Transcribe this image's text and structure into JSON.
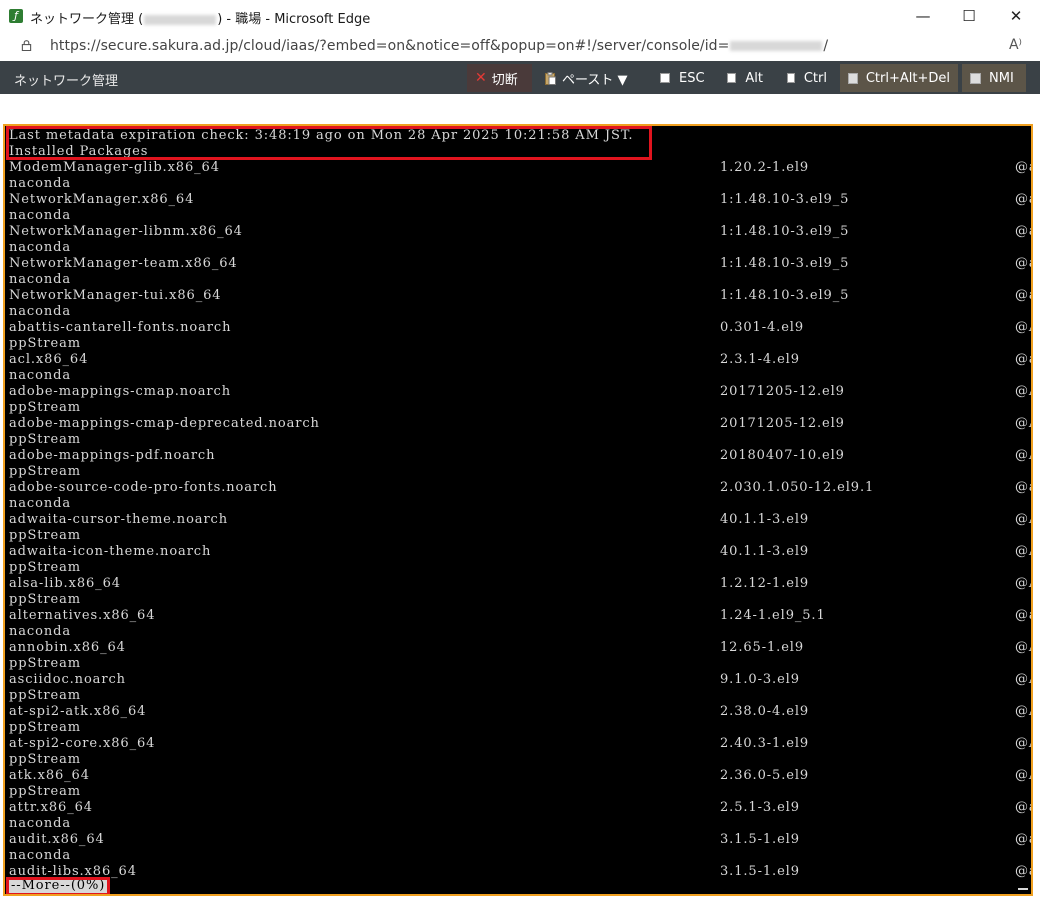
{
  "window": {
    "title_prefix": "ネットワーク管理 (",
    "title_suffix": ") - 職場 - Microsoft Edge",
    "minimize_glyph": "—",
    "maximize_glyph": "☐",
    "close_glyph": "✕"
  },
  "address": {
    "url_prefix": "https://secure.sakura.ad.jp/cloud/iaas/?embed=on&notice=off&popup=on#!/server/console/id=",
    "url_suffix": "/",
    "reader_glyph": "A⁾"
  },
  "toolbar": {
    "title": "ネットワーク管理",
    "disconnect_label": "切断",
    "paste_label": "ペースト ▼",
    "esc_label": "ESC",
    "alt_label": "Alt",
    "ctrl_label": "Ctrl",
    "ctrl_alt_del_label": "Ctrl+Alt+Del",
    "nmi_label": "NMI"
  },
  "console": {
    "header_1": "Last metadata expiration check: 3:48:19 ago on Mon 28 Apr 2025 10:21:58 AM JST.",
    "header_2": "Installed Packages",
    "packages": [
      {
        "name": "ModemManager-glib.x86_64",
        "version": "1.20.2-1.el9",
        "repo": "@a",
        "repo2": "naconda"
      },
      {
        "name": "NetworkManager.x86_64",
        "version": "1:1.48.10-3.el9_5",
        "repo": "@a",
        "repo2": "naconda"
      },
      {
        "name": "NetworkManager-libnm.x86_64",
        "version": "1:1.48.10-3.el9_5",
        "repo": "@a",
        "repo2": "naconda"
      },
      {
        "name": "NetworkManager-team.x86_64",
        "version": "1:1.48.10-3.el9_5",
        "repo": "@a",
        "repo2": "naconda"
      },
      {
        "name": "NetworkManager-tui.x86_64",
        "version": "1:1.48.10-3.el9_5",
        "repo": "@a",
        "repo2": "naconda"
      },
      {
        "name": "abattis-cantarell-fonts.noarch",
        "version": "0.301-4.el9",
        "repo": "@A",
        "repo2": "ppStream"
      },
      {
        "name": "acl.x86_64",
        "version": "2.3.1-4.el9",
        "repo": "@a",
        "repo2": "naconda"
      },
      {
        "name": "adobe-mappings-cmap.noarch",
        "version": "20171205-12.el9",
        "repo": "@A",
        "repo2": "ppStream"
      },
      {
        "name": "adobe-mappings-cmap-deprecated.noarch",
        "version": "20171205-12.el9",
        "repo": "@A",
        "repo2": "ppStream"
      },
      {
        "name": "adobe-mappings-pdf.noarch",
        "version": "20180407-10.el9",
        "repo": "@A",
        "repo2": "ppStream"
      },
      {
        "name": "adobe-source-code-pro-fonts.noarch",
        "version": "2.030.1.050-12.el9.1",
        "repo": "@a",
        "repo2": "naconda"
      },
      {
        "name": "adwaita-cursor-theme.noarch",
        "version": "40.1.1-3.el9",
        "repo": "@A",
        "repo2": "ppStream"
      },
      {
        "name": "adwaita-icon-theme.noarch",
        "version": "40.1.1-3.el9",
        "repo": "@A",
        "repo2": "ppStream"
      },
      {
        "name": "alsa-lib.x86_64",
        "version": "1.2.12-1.el9",
        "repo": "@A",
        "repo2": "ppStream"
      },
      {
        "name": "alternatives.x86_64",
        "version": "1.24-1.el9_5.1",
        "repo": "@a",
        "repo2": "naconda"
      },
      {
        "name": "annobin.x86_64",
        "version": "12.65-1.el9",
        "repo": "@A",
        "repo2": "ppStream"
      },
      {
        "name": "asciidoc.noarch",
        "version": "9.1.0-3.el9",
        "repo": "@A",
        "repo2": "ppStream"
      },
      {
        "name": "at-spi2-atk.x86_64",
        "version": "2.38.0-4.el9",
        "repo": "@A",
        "repo2": "ppStream"
      },
      {
        "name": "at-spi2-core.x86_64",
        "version": "2.40.3-1.el9",
        "repo": "@A",
        "repo2": "ppStream"
      },
      {
        "name": "atk.x86_64",
        "version": "2.36.0-5.el9",
        "repo": "@A",
        "repo2": "ppStream"
      },
      {
        "name": "attr.x86_64",
        "version": "2.5.1-3.el9",
        "repo": "@a",
        "repo2": "naconda"
      },
      {
        "name": "audit.x86_64",
        "version": "3.1.5-1.el9",
        "repo": "@a",
        "repo2": "naconda"
      },
      {
        "name": "audit-libs.x86_64",
        "version": "3.1.5-1.el9",
        "repo": "@a",
        "repo2": ""
      }
    ],
    "more_prompt": "--More--(0%)"
  },
  "colors": {
    "toolbar_bg": "#3a4146",
    "console_bg": "#000000",
    "console_border": "#f0a020",
    "highlight": "#e0141e"
  }
}
